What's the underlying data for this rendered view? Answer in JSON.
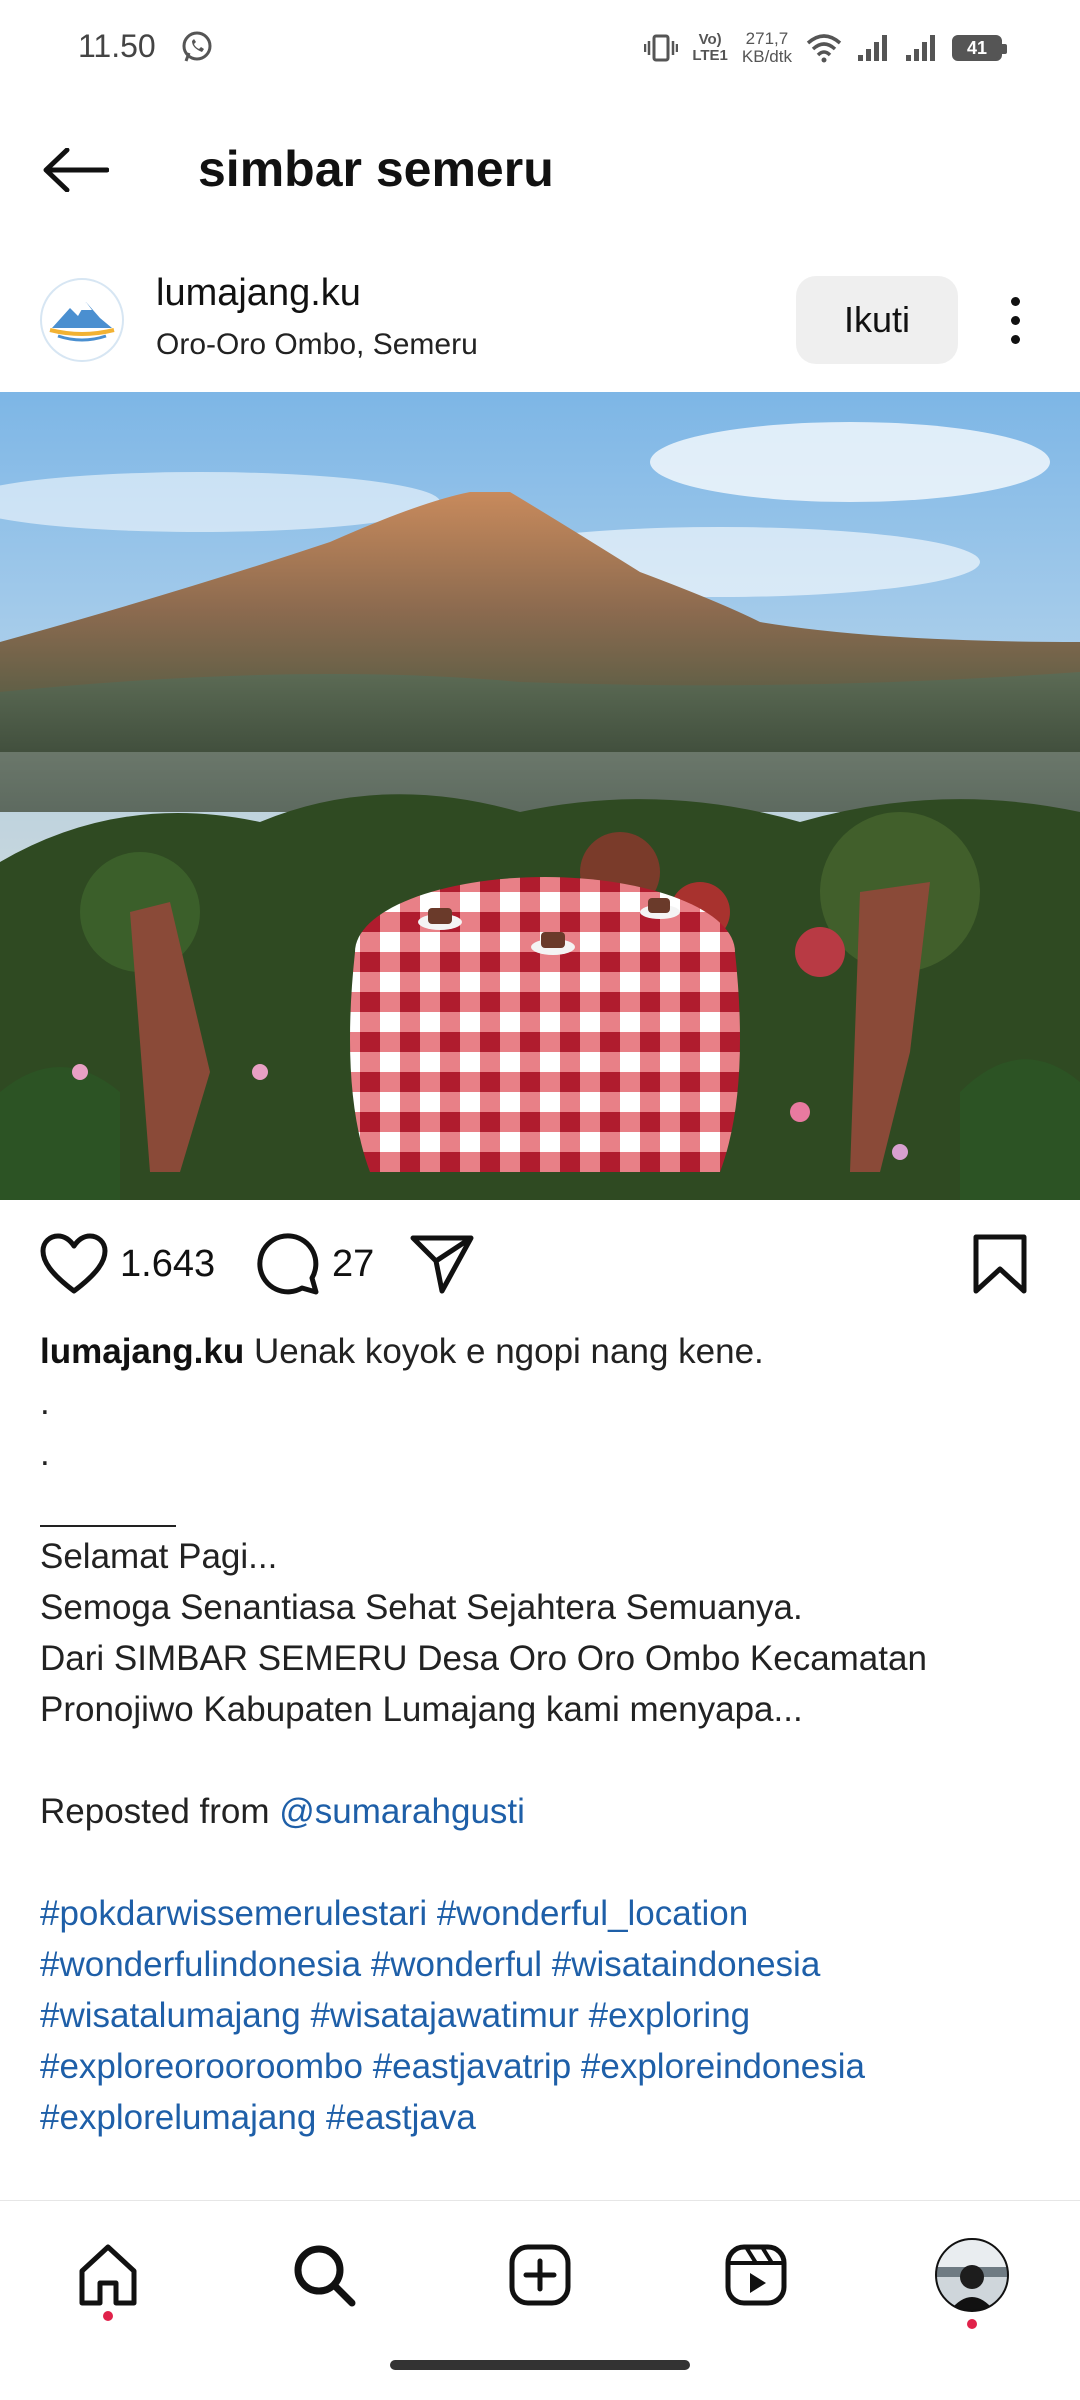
{
  "status_bar": {
    "time": "11.50",
    "lte_top": "Vo)",
    "lte_bottom": "LTE1",
    "speed_value": "271,7",
    "speed_unit": "KB/dtk",
    "battery": "41"
  },
  "header": {
    "title": "simbar semeru"
  },
  "post": {
    "username": "lumajang.ku",
    "location": "Oro-Oro Ombo, Semeru",
    "follow_label": "Ikuti",
    "likes": "1.643",
    "comments": "27"
  },
  "caption": {
    "username": "lumajang.ku",
    "first_line": "Uenak koyok e ngopi nang kene.",
    "dot1": ".",
    "dot2": ".",
    "line_greeting": "Selamat Pagi...",
    "line_wish": "Semoga Senantiasa Sehat Sejahtera Semuanya.",
    "line_from_1": "Dari SIMBAR SEMERU Desa Oro Oro Ombo Kecamatan",
    "line_from_2": "Pronojiwo Kabupaten Lumajang  kami menyapa...",
    "reposted_prefix": "Reposted from ",
    "reposted_user": "@sumarahgusti",
    "hashtags": [
      [
        "#pokdarwissemerulestari",
        "#wonderful_location"
      ],
      [
        "#wonderfulindonesia",
        "#wonderful",
        "#wisataindonesia"
      ],
      [
        "#wisatalumajang",
        "#wisatajawatimur",
        "#exploring"
      ],
      [
        "#exploreorooroombo",
        "#eastjavatrip",
        "#exploreindonesia"
      ],
      [
        "#explorelumajang",
        "#eastjava"
      ]
    ]
  },
  "colors": {
    "link": "#1e5fa8",
    "notification_dot": "#e0224a"
  },
  "icons": {
    "back": "arrow-left-icon",
    "more": "more-vertical-icon",
    "like": "heart-icon",
    "comment": "comment-icon",
    "share": "paper-plane-icon",
    "save": "bookmark-icon",
    "nav": [
      "home-icon",
      "search-icon",
      "add-icon",
      "reels-icon",
      "profile-avatar"
    ]
  }
}
